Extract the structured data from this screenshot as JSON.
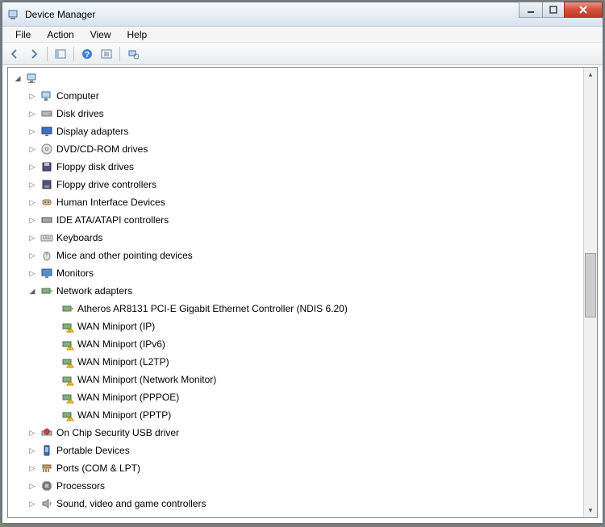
{
  "window": {
    "title": "Device Manager"
  },
  "menu": {
    "file": "File",
    "action": "Action",
    "view": "View",
    "help": "Help"
  },
  "tree": {
    "root": {
      "label": ""
    },
    "categories": [
      {
        "label": "Computer",
        "expanded": false,
        "icon": "computer"
      },
      {
        "label": "Disk drives",
        "expanded": false,
        "icon": "disk"
      },
      {
        "label": "Display adapters",
        "expanded": false,
        "icon": "display"
      },
      {
        "label": "DVD/CD-ROM drives",
        "expanded": false,
        "icon": "dvd"
      },
      {
        "label": "Floppy disk drives",
        "expanded": false,
        "icon": "floppy"
      },
      {
        "label": "Floppy drive controllers",
        "expanded": false,
        "icon": "floppy-ctrl"
      },
      {
        "label": "Human Interface Devices",
        "expanded": false,
        "icon": "hid"
      },
      {
        "label": "IDE ATA/ATAPI controllers",
        "expanded": false,
        "icon": "ide"
      },
      {
        "label": "Keyboards",
        "expanded": false,
        "icon": "keyboard"
      },
      {
        "label": "Mice and other pointing devices",
        "expanded": false,
        "icon": "mouse"
      },
      {
        "label": "Monitors",
        "expanded": false,
        "icon": "monitor"
      },
      {
        "label": "Network adapters",
        "expanded": true,
        "icon": "network",
        "children": [
          {
            "label": "Atheros AR8131 PCI-E Gigabit Ethernet Controller (NDIS 6.20)",
            "icon": "nic"
          },
          {
            "label": "WAN Miniport (IP)",
            "icon": "nic-warn"
          },
          {
            "label": "WAN Miniport (IPv6)",
            "icon": "nic-warn"
          },
          {
            "label": "WAN Miniport (L2TP)",
            "icon": "nic-warn"
          },
          {
            "label": "WAN Miniport (Network Monitor)",
            "icon": "nic-warn"
          },
          {
            "label": "WAN Miniport (PPPOE)",
            "icon": "nic-warn"
          },
          {
            "label": "WAN Miniport (PPTP)",
            "icon": "nic-warn"
          }
        ]
      },
      {
        "label": "On Chip Security USB driver",
        "expanded": false,
        "icon": "security"
      },
      {
        "label": "Portable Devices",
        "expanded": false,
        "icon": "portable"
      },
      {
        "label": "Ports (COM & LPT)",
        "expanded": false,
        "icon": "ports"
      },
      {
        "label": "Processors",
        "expanded": false,
        "icon": "cpu"
      },
      {
        "label": "Sound, video and game controllers",
        "expanded": false,
        "icon": "sound"
      }
    ]
  }
}
